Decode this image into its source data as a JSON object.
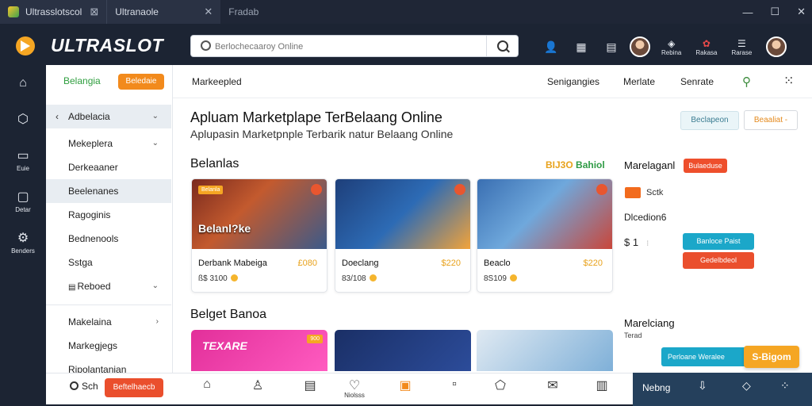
{
  "window": {
    "tabs": [
      {
        "label": "Ultrasslotscol",
        "active": true
      },
      {
        "label": "Ultranaole",
        "active": true
      },
      {
        "label": "Fradab",
        "active": false
      }
    ],
    "controls": [
      "—",
      "☐",
      "✕"
    ]
  },
  "brand": {
    "logo_text": "ULTRASLOT",
    "accent": "#f5b52d"
  },
  "search": {
    "placeholder": "Berlochecaaroy Online"
  },
  "header_labels": {
    "item1": "Rebina",
    "item2": "Rakasa",
    "item3": "Rarase"
  },
  "rail": {
    "items": [
      {
        "icon": "home-icon"
      },
      {
        "icon": "box-icon"
      },
      {
        "label": "Euie"
      },
      {
        "label": "Detar"
      },
      {
        "label": "Benders"
      }
    ]
  },
  "sidebar": {
    "tab_green": "Belangia",
    "tab_orange": "Beledaie",
    "header": "Adbelacia",
    "items": [
      "Mekeplera",
      "Derkeaaner",
      "Beelenanes",
      "Ragoginis",
      "Bednenools",
      "Sstga",
      "Reboed"
    ],
    "items2": [
      "Makelaina",
      "Markegjegs",
      "Ripolantanian"
    ]
  },
  "topnav": {
    "left": "Markeepled",
    "right": [
      "Senigangies",
      "Merlate",
      "Senrate"
    ]
  },
  "hero": {
    "title": "Apluam Marketplape TerBelaang Online",
    "subtitle": "Aplupasin Marketpnple Terbarik natur Belaang Online",
    "btn1": "Beclapeon",
    "btn2": "Beaaliat -"
  },
  "section1": {
    "title": "Belanlas",
    "link_a": "BIJ3O",
    "link_b": "Bahiol"
  },
  "cards": [
    {
      "badge": "Belanla",
      "overlay": "Belanl?ke",
      "title": "Derbank Mabeiga",
      "price": "£080",
      "sub": "ß$ 3100"
    },
    {
      "badge": "",
      "overlay": "",
      "title": "Doeclang",
      "price": "$220",
      "sub": "83/108"
    },
    {
      "badge": "",
      "overlay": "",
      "title": "Beaclo",
      "price": "$220",
      "sub": "8S109"
    }
  ],
  "section2": {
    "title": "Belget Banoa",
    "cards": [
      {
        "text": "TEXARE",
        "tag": "900"
      },
      {
        "text": ""
      },
      {
        "text": ""
      }
    ]
  },
  "right": {
    "title": "Marelaganl",
    "tag": "Bulaeduse",
    "label1": "Sctk",
    "label2": "Dlcedion6",
    "price": "$ 1",
    "btn_teal": "Banloce Paist",
    "btn_red": "Gedelbdeol",
    "title2": "Marelciang",
    "sub2": "Terad",
    "bar_label": "Perloane   Weralee",
    "float_btn": "S-Bigom"
  },
  "bottombar": {
    "search_label": "Sch",
    "btn": "Beftelhaecb",
    "center_label": "Niolsss",
    "dark_label": "Nebng"
  }
}
